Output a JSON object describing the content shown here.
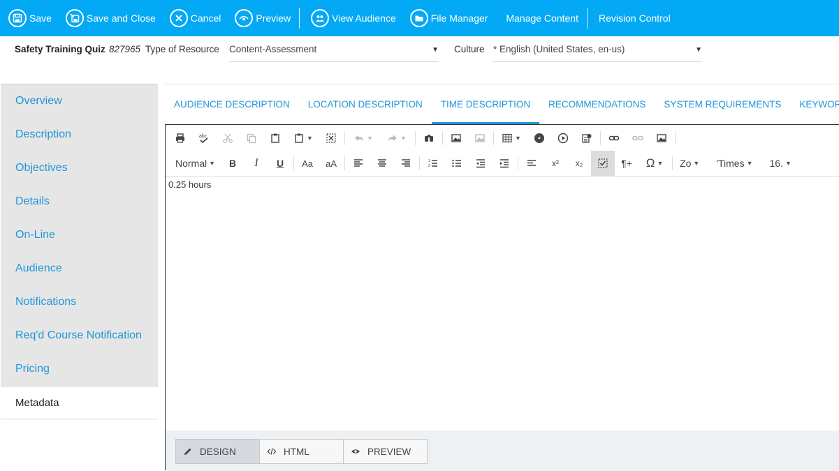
{
  "toolbar": {
    "save": "Save",
    "save_close": "Save and Close",
    "cancel": "Cancel",
    "preview": "Preview",
    "view_audience": "View Audience",
    "file_manager": "File Manager",
    "manage_content": "Manage Content",
    "revision_control": "Revision Control"
  },
  "header": {
    "title": "Safety Training Quiz",
    "resource_id": "827965",
    "type_label": "Type of Resource",
    "type_value": "Content-Assessment",
    "culture_label": "Culture",
    "culture_value": "* English (United States, en-us)"
  },
  "nav": {
    "items": [
      {
        "label": "Overview"
      },
      {
        "label": "Description"
      },
      {
        "label": "Objectives"
      },
      {
        "label": "Details"
      },
      {
        "label": "On-Line"
      },
      {
        "label": "Audience"
      },
      {
        "label": "Notifications"
      },
      {
        "label": "Req'd Course Notification"
      },
      {
        "label": "Pricing"
      },
      {
        "label": "Metadata"
      }
    ],
    "active": "Metadata"
  },
  "tabs": {
    "items": [
      {
        "label": "AUDIENCE DESCRIPTION"
      },
      {
        "label": "LOCATION DESCRIPTION"
      },
      {
        "label": "TIME DESCRIPTION"
      },
      {
        "label": "RECOMMENDATIONS"
      },
      {
        "label": "SYSTEM REQUIREMENTS"
      },
      {
        "label": "KEYWORDS"
      }
    ],
    "active": "TIME DESCRIPTION"
  },
  "editor": {
    "format_select": "Normal",
    "bold": "B",
    "italic": "I",
    "underline": "U",
    "case_title": "Aa",
    "case_lower": "aA",
    "superscript": "x²",
    "subscript": "x₂",
    "paragraph": "¶+",
    "omega": "Ω",
    "zoom_select": "Zo",
    "font_select": "'Times",
    "size_select": "16.",
    "content": "0.25 hours"
  },
  "modes": {
    "design": "DESIGN",
    "html": "HTML",
    "preview": "PREVIEW",
    "active": "DESIGN"
  },
  "colors": {
    "toolbar_bg": "#03a9f4",
    "accent": "#2196d8",
    "nav_bg": "#e6e6e6"
  }
}
